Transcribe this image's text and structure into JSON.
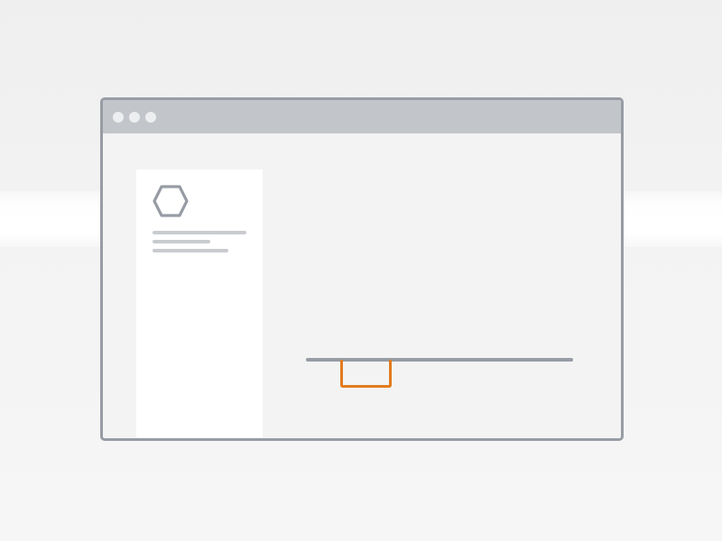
{
  "window": {
    "title_dots": [
      "close",
      "minimize",
      "maximize"
    ]
  },
  "sidebar": {
    "icon": "hexagon-icon"
  },
  "content": {
    "rail": "divider",
    "drawer": "pull-tab"
  },
  "colors": {
    "frame": "#979ca4",
    "titlebar": "#c2c5c9",
    "placeholder_line": "#c9cbcf",
    "accent": "#e27b1e",
    "card": "#ffffff",
    "window_bg": "#f3f3f3"
  }
}
